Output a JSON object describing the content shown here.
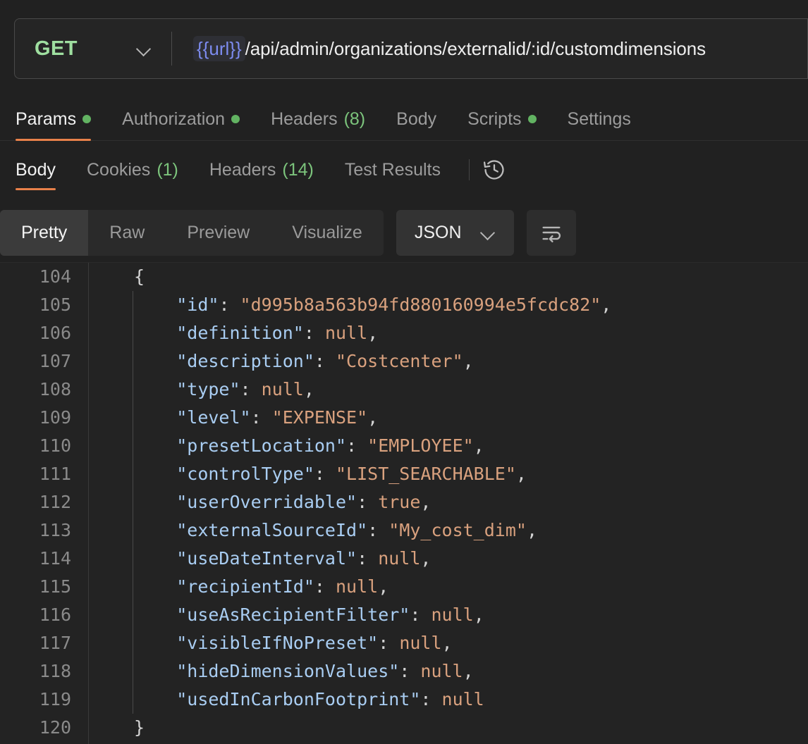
{
  "request": {
    "method": "GET",
    "url_variable": "{{url}}",
    "url_path": "/api/admin/organizations/externalid/:id/customdimensions",
    "tabs": [
      {
        "label": "Params",
        "badge": "",
        "dot": true,
        "active": true
      },
      {
        "label": "Authorization",
        "badge": "",
        "dot": true,
        "active": false
      },
      {
        "label": "Headers",
        "badge": "(8)",
        "dot": false,
        "active": false
      },
      {
        "label": "Body",
        "badge": "",
        "dot": false,
        "active": false
      },
      {
        "label": "Scripts",
        "badge": "",
        "dot": true,
        "active": false
      },
      {
        "label": "Settings",
        "badge": "",
        "dot": false,
        "active": false
      }
    ]
  },
  "response": {
    "tabs": [
      {
        "label": "Body",
        "badge": "",
        "active": true
      },
      {
        "label": "Cookies",
        "badge": "(1)",
        "active": false
      },
      {
        "label": "Headers",
        "badge": "(14)",
        "active": false
      },
      {
        "label": "Test Results",
        "badge": "",
        "active": false
      }
    ],
    "history_icon": "history-clock-icon",
    "format_modes": [
      {
        "label": "Pretty",
        "active": true
      },
      {
        "label": "Raw",
        "active": false
      },
      {
        "label": "Preview",
        "active": false
      },
      {
        "label": "Visualize",
        "active": false
      }
    ],
    "language": "JSON",
    "wrap_icon": "word-wrap-icon",
    "code": {
      "first_line_number": 104,
      "lines": [
        {
          "n": "104",
          "indent": 0,
          "tokens": [
            {
              "t": "p",
              "v": "{"
            }
          ]
        },
        {
          "n": "105",
          "indent": 1,
          "tokens": [
            {
              "t": "k",
              "v": "\"id\""
            },
            {
              "t": "p",
              "v": ": "
            },
            {
              "t": "s",
              "v": "\"d995b8a563b94fd880160994e5fcdc82\""
            },
            {
              "t": "p",
              "v": ","
            }
          ]
        },
        {
          "n": "106",
          "indent": 1,
          "tokens": [
            {
              "t": "k",
              "v": "\"definition\""
            },
            {
              "t": "p",
              "v": ": "
            },
            {
              "t": "n",
              "v": "null"
            },
            {
              "t": "p",
              "v": ","
            }
          ]
        },
        {
          "n": "107",
          "indent": 1,
          "tokens": [
            {
              "t": "k",
              "v": "\"description\""
            },
            {
              "t": "p",
              "v": ": "
            },
            {
              "t": "s",
              "v": "\"Costcenter\""
            },
            {
              "t": "p",
              "v": ","
            }
          ]
        },
        {
          "n": "108",
          "indent": 1,
          "tokens": [
            {
              "t": "k",
              "v": "\"type\""
            },
            {
              "t": "p",
              "v": ": "
            },
            {
              "t": "n",
              "v": "null"
            },
            {
              "t": "p",
              "v": ","
            }
          ]
        },
        {
          "n": "109",
          "indent": 1,
          "tokens": [
            {
              "t": "k",
              "v": "\"level\""
            },
            {
              "t": "p",
              "v": ": "
            },
            {
              "t": "s",
              "v": "\"EXPENSE\""
            },
            {
              "t": "p",
              "v": ","
            }
          ]
        },
        {
          "n": "110",
          "indent": 1,
          "tokens": [
            {
              "t": "k",
              "v": "\"presetLocation\""
            },
            {
              "t": "p",
              "v": ": "
            },
            {
              "t": "s",
              "v": "\"EMPLOYEE\""
            },
            {
              "t": "p",
              "v": ","
            }
          ]
        },
        {
          "n": "111",
          "indent": 1,
          "tokens": [
            {
              "t": "k",
              "v": "\"controlType\""
            },
            {
              "t": "p",
              "v": ": "
            },
            {
              "t": "s",
              "v": "\"LIST_SEARCHABLE\""
            },
            {
              "t": "p",
              "v": ","
            }
          ]
        },
        {
          "n": "112",
          "indent": 1,
          "tokens": [
            {
              "t": "k",
              "v": "\"userOverridable\""
            },
            {
              "t": "p",
              "v": ": "
            },
            {
              "t": "b",
              "v": "true"
            },
            {
              "t": "p",
              "v": ","
            }
          ]
        },
        {
          "n": "113",
          "indent": 1,
          "tokens": [
            {
              "t": "k",
              "v": "\"externalSourceId\""
            },
            {
              "t": "p",
              "v": ": "
            },
            {
              "t": "s",
              "v": "\"My_cost_dim\""
            },
            {
              "t": "p",
              "v": ","
            }
          ]
        },
        {
          "n": "114",
          "indent": 1,
          "tokens": [
            {
              "t": "k",
              "v": "\"useDateInterval\""
            },
            {
              "t": "p",
              "v": ": "
            },
            {
              "t": "n",
              "v": "null"
            },
            {
              "t": "p",
              "v": ","
            }
          ]
        },
        {
          "n": "115",
          "indent": 1,
          "tokens": [
            {
              "t": "k",
              "v": "\"recipientId\""
            },
            {
              "t": "p",
              "v": ": "
            },
            {
              "t": "n",
              "v": "null"
            },
            {
              "t": "p",
              "v": ","
            }
          ]
        },
        {
          "n": "116",
          "indent": 1,
          "tokens": [
            {
              "t": "k",
              "v": "\"useAsRecipientFilter\""
            },
            {
              "t": "p",
              "v": ": "
            },
            {
              "t": "n",
              "v": "null"
            },
            {
              "t": "p",
              "v": ","
            }
          ]
        },
        {
          "n": "117",
          "indent": 1,
          "tokens": [
            {
              "t": "k",
              "v": "\"visibleIfNoPreset\""
            },
            {
              "t": "p",
              "v": ": "
            },
            {
              "t": "n",
              "v": "null"
            },
            {
              "t": "p",
              "v": ","
            }
          ]
        },
        {
          "n": "118",
          "indent": 1,
          "tokens": [
            {
              "t": "k",
              "v": "\"hideDimensionValues\""
            },
            {
              "t": "p",
              "v": ": "
            },
            {
              "t": "n",
              "v": "null"
            },
            {
              "t": "p",
              "v": ","
            }
          ]
        },
        {
          "n": "119",
          "indent": 1,
          "tokens": [
            {
              "t": "k",
              "v": "\"usedInCarbonFootprint\""
            },
            {
              "t": "p",
              "v": ": "
            },
            {
              "t": "n",
              "v": "null"
            }
          ]
        },
        {
          "n": "120",
          "indent": 0,
          "tokens": [
            {
              "t": "p",
              "v": "}"
            }
          ]
        }
      ]
    }
  },
  "colors": {
    "accent_underline": "#e8814a",
    "method_get": "#9fdfa0",
    "status_dot": "#62b362",
    "variable": "#7d8cf0",
    "json_key": "#a9cdf2",
    "json_string": "#d9a17e",
    "background": "#212121",
    "code_background": "#232323"
  }
}
